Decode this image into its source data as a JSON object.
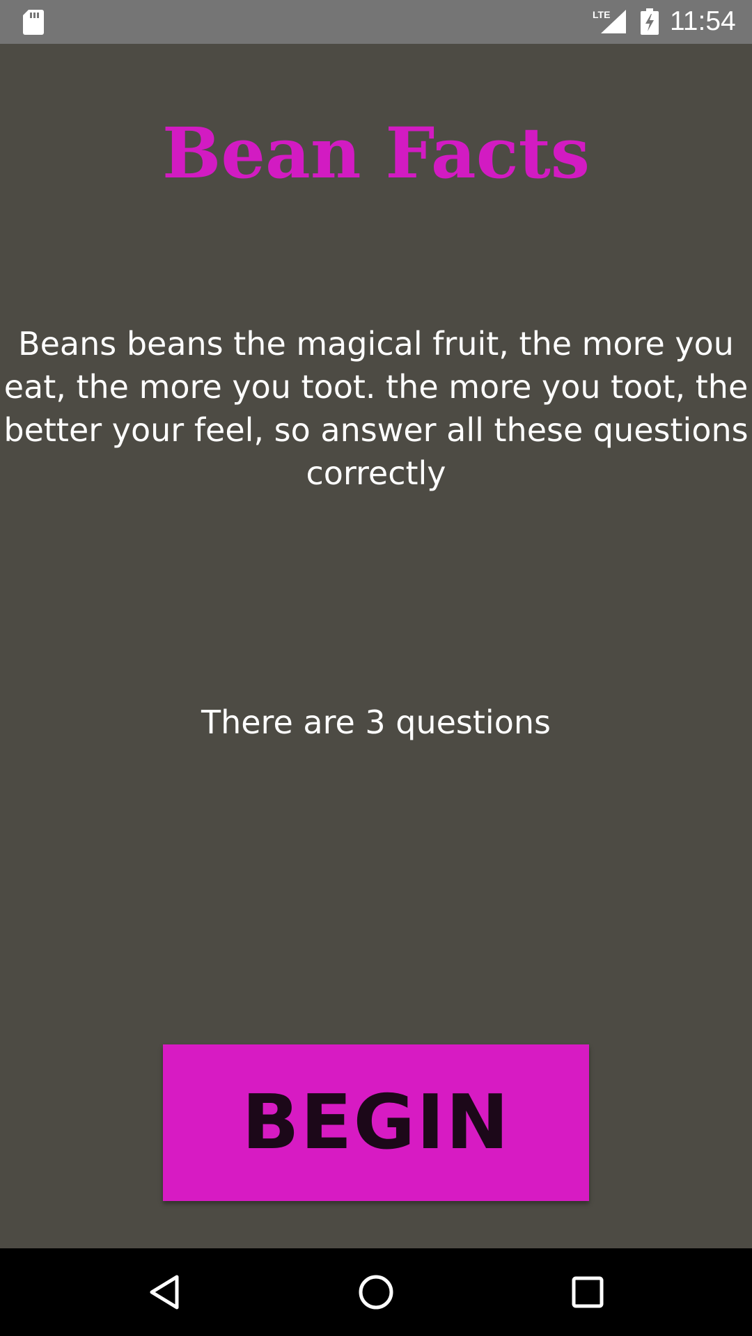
{
  "status_bar": {
    "time": "11:54",
    "network_label": "LTE",
    "icons": [
      "sd-card-icon",
      "lte-signal-icon",
      "battery-charging-icon"
    ]
  },
  "main": {
    "title": "Bean Facts",
    "intro": "Beans beans the magical fruit, the more you eat, the more you toot. the more you toot, the better your feel, so answer all these questions correctly",
    "question_count": "There are 3 questions",
    "begin_label": "BEGIN"
  },
  "nav_bar": {
    "icons": [
      "back-icon",
      "home-icon",
      "recents-icon"
    ]
  },
  "colors": {
    "background": "#4d4b44",
    "accent": "#d71bc3",
    "title": "#d21bc2",
    "button_text": "#1c0819",
    "status_bar": "#757575",
    "nav_bar": "#000000"
  }
}
